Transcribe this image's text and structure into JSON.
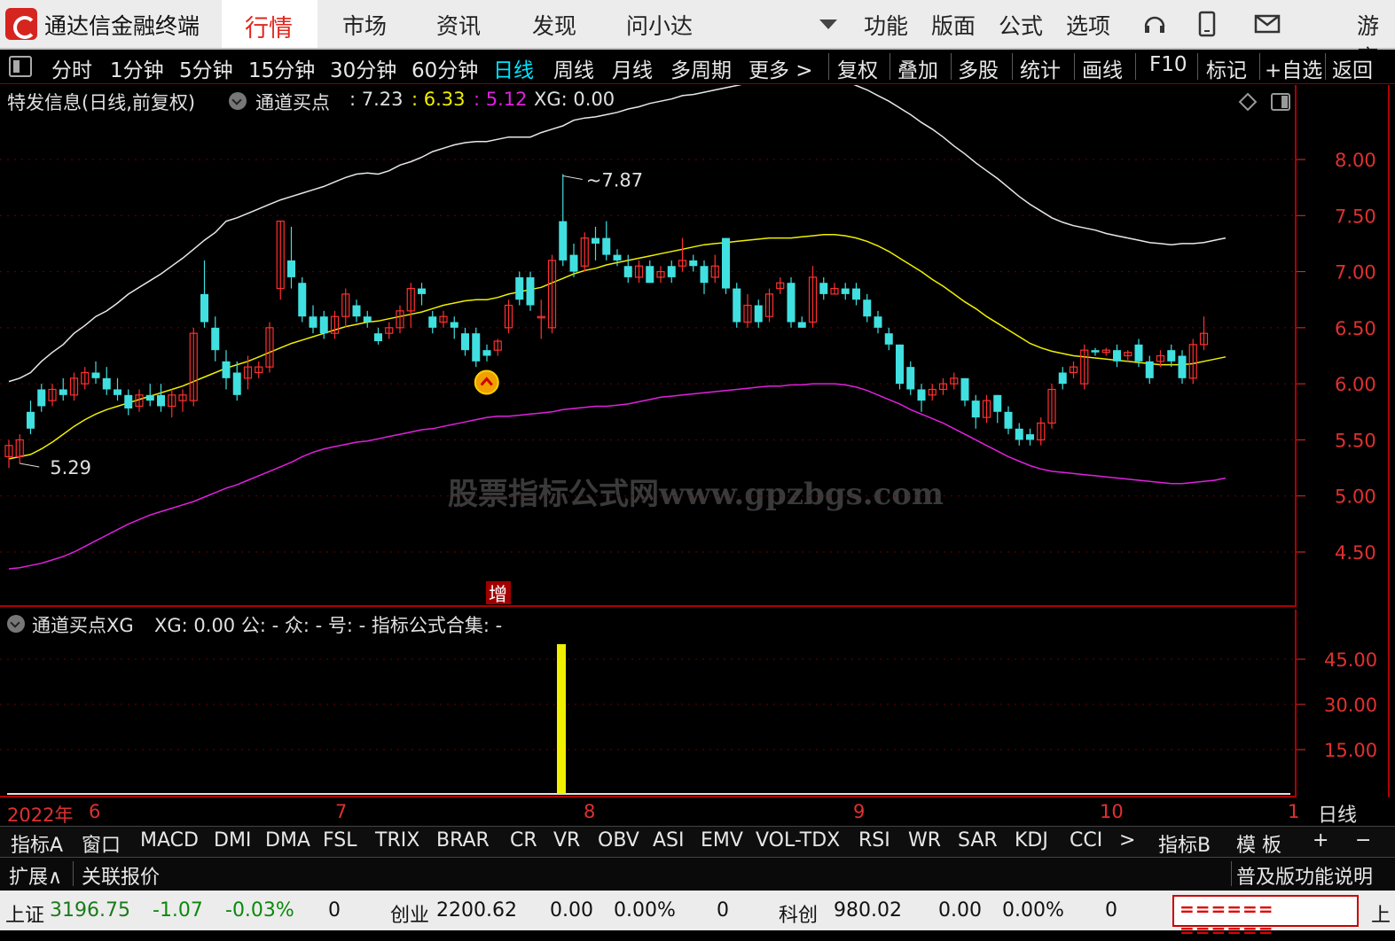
{
  "titlebar": {
    "app_title": "通达信金融终端",
    "menus": [
      "行情",
      "市场",
      "资讯",
      "发现",
      "问小达",
      "功能",
      "版面",
      "公式",
      "选项",
      "游客"
    ],
    "active_menu": "行情"
  },
  "toolbar": {
    "periods": [
      "分时",
      "1分钟",
      "5分钟",
      "15分钟",
      "30分钟",
      "60分钟",
      "日线",
      "周线",
      "月线",
      "多周期",
      "更多 >"
    ],
    "active_period": "日线",
    "actions": [
      "复权",
      "叠加",
      "多股",
      "统计",
      "画线",
      "F10",
      "标记",
      "+自选",
      "返回"
    ]
  },
  "main_chart": {
    "title": "特发信息(日线,前复权)",
    "indicator_name": "通道买点",
    "values": [
      ": 7.23",
      ": 6.33",
      ": 5.12"
    ],
    "xg_label": "XG: 0.00",
    "colors": {
      "upper": "#e8e8e8",
      "mid": "#f0f000",
      "lower": "#e020e0",
      "up_candle": "#ff3030",
      "down_candle": "#40e0e0"
    },
    "high_label": "7.87",
    "low_label": "5.29",
    "y_ticks": [
      "8.00",
      "7.50",
      "7.00",
      "6.50",
      "6.00",
      "5.50",
      "5.00",
      "4.50"
    ],
    "y_tick_values": [
      8.0,
      7.5,
      7.0,
      6.5,
      6.0,
      5.5,
      5.0,
      4.5
    ],
    "badge": "增",
    "watermark": "股票指标公式网www.gpzbgs.com"
  },
  "chart_data": {
    "type": "candlestick",
    "title": "特发信息(日线,前复权)",
    "ylim": [
      4.3,
      8.4
    ],
    "candles": [
      [
        5.35,
        5.45,
        5.25,
        5.5
      ],
      [
        5.35,
        5.5,
        5.29,
        5.55
      ],
      [
        5.75,
        5.6,
        5.55,
        5.85
      ],
      [
        5.95,
        5.8,
        5.75,
        6.0
      ],
      [
        5.85,
        5.95,
        5.8,
        6.0
      ],
      [
        5.95,
        5.9,
        5.85,
        6.05
      ],
      [
        5.9,
        6.05,
        5.85,
        6.1
      ],
      [
        6.0,
        6.1,
        5.95,
        6.15
      ],
      [
        6.1,
        6.05,
        6.0,
        6.2
      ],
      [
        6.05,
        5.95,
        5.9,
        6.15
      ],
      [
        5.95,
        5.9,
        5.85,
        6.05
      ],
      [
        5.9,
        5.78,
        5.72,
        5.95
      ],
      [
        5.8,
        5.9,
        5.75,
        5.95
      ],
      [
        5.9,
        5.85,
        5.8,
        6.0
      ],
      [
        5.9,
        5.8,
        5.75,
        6.0
      ],
      [
        5.8,
        5.9,
        5.7,
        5.95
      ],
      [
        5.85,
        5.9,
        5.75,
        5.95
      ],
      [
        5.85,
        6.45,
        5.8,
        6.5
      ],
      [
        6.8,
        6.55,
        6.5,
        7.1
      ],
      [
        6.5,
        6.3,
        6.2,
        6.6
      ],
      [
        6.2,
        6.05,
        5.95,
        6.3
      ],
      [
        6.1,
        5.9,
        5.85,
        6.2
      ],
      [
        6.05,
        6.15,
        5.95,
        6.25
      ],
      [
        6.1,
        6.15,
        6.05,
        6.2
      ],
      [
        6.15,
        6.5,
        6.1,
        6.55
      ],
      [
        6.85,
        7.45,
        6.75,
        7.45
      ],
      [
        7.1,
        6.95,
        6.85,
        7.4
      ],
      [
        6.9,
        6.6,
        6.55,
        6.95
      ],
      [
        6.6,
        6.5,
        6.45,
        6.7
      ],
      [
        6.6,
        6.45,
        6.4,
        6.65
      ],
      [
        6.45,
        6.6,
        6.4,
        6.65
      ],
      [
        6.6,
        6.8,
        6.5,
        6.85
      ],
      [
        6.7,
        6.6,
        6.55,
        6.75
      ],
      [
        6.6,
        6.55,
        6.5,
        6.65
      ],
      [
        6.45,
        6.38,
        6.35,
        6.5
      ],
      [
        6.45,
        6.5,
        6.4,
        6.55
      ],
      [
        6.5,
        6.65,
        6.45,
        6.7
      ],
      [
        6.65,
        6.85,
        6.5,
        6.9
      ],
      [
        6.85,
        6.8,
        6.7,
        6.9
      ],
      [
        6.6,
        6.5,
        6.45,
        6.65
      ],
      [
        6.55,
        6.6,
        6.5,
        6.65
      ],
      [
        6.55,
        6.5,
        6.4,
        6.6
      ],
      [
        6.45,
        6.3,
        6.25,
        6.5
      ],
      [
        6.45,
        6.2,
        6.15,
        6.5
      ],
      [
        6.3,
        6.25,
        6.2,
        6.35
      ],
      [
        6.3,
        6.38,
        6.25,
        6.4
      ],
      [
        6.5,
        6.7,
        6.45,
        6.75
      ],
      [
        6.95,
        6.75,
        6.7,
        7.0
      ],
      [
        6.95,
        6.7,
        6.65,
        7.0
      ],
      [
        6.6,
        6.6,
        6.4,
        6.75
      ],
      [
        6.5,
        7.1,
        6.45,
        7.15
      ],
      [
        7.45,
        7.1,
        7.05,
        7.87
      ],
      [
        7.15,
        7.0,
        6.95,
        7.25
      ],
      [
        7.05,
        7.3,
        7.0,
        7.35
      ],
      [
        7.3,
        7.25,
        7.1,
        7.4
      ],
      [
        7.3,
        7.15,
        7.1,
        7.45
      ],
      [
        7.15,
        7.1,
        7.05,
        7.2
      ],
      [
        7.05,
        6.95,
        6.9,
        7.15
      ],
      [
        6.95,
        7.05,
        6.9,
        7.1
      ],
      [
        7.05,
        6.9,
        6.9,
        7.1
      ],
      [
        6.95,
        7.0,
        6.9,
        7.05
      ],
      [
        7.05,
        6.95,
        6.9,
        7.1
      ],
      [
        7.05,
        7.1,
        7.0,
        7.3
      ],
      [
        7.1,
        7.05,
        7.0,
        7.15
      ],
      [
        7.05,
        6.9,
        6.8,
        7.1
      ],
      [
        6.95,
        7.05,
        6.9,
        7.15
      ],
      [
        7.3,
        6.85,
        6.8,
        7.3
      ],
      [
        6.85,
        6.55,
        6.5,
        6.9
      ],
      [
        6.55,
        6.7,
        6.5,
        6.8
      ],
      [
        6.7,
        6.55,
        6.5,
        6.75
      ],
      [
        6.6,
        6.8,
        6.55,
        6.85
      ],
      [
        6.85,
        6.9,
        6.8,
        6.95
      ],
      [
        6.9,
        6.55,
        6.5,
        6.95
      ],
      [
        6.55,
        6.5,
        6.5,
        6.6
      ],
      [
        6.55,
        6.95,
        6.5,
        7.05
      ],
      [
        6.9,
        6.8,
        6.75,
        6.95
      ],
      [
        6.8,
        6.85,
        6.8,
        6.9
      ],
      [
        6.85,
        6.8,
        6.75,
        6.9
      ],
      [
        6.85,
        6.75,
        6.7,
        6.9
      ],
      [
        6.75,
        6.6,
        6.55,
        6.8
      ],
      [
        6.6,
        6.5,
        6.45,
        6.65
      ],
      [
        6.45,
        6.35,
        6.3,
        6.5
      ],
      [
        6.35,
        6.0,
        5.95,
        6.35
      ],
      [
        6.15,
        5.95,
        5.9,
        6.2
      ],
      [
        5.95,
        5.85,
        5.75,
        6.0
      ],
      [
        5.9,
        5.95,
        5.85,
        6.0
      ],
      [
        5.95,
        6.0,
        5.9,
        6.05
      ],
      [
        6.0,
        6.05,
        5.95,
        6.1
      ],
      [
        6.05,
        5.85,
        5.8,
        6.05
      ],
      [
        5.85,
        5.7,
        5.6,
        5.9
      ],
      [
        5.7,
        5.85,
        5.65,
        5.9
      ],
      [
        5.9,
        5.75,
        5.65,
        5.9
      ],
      [
        5.75,
        5.6,
        5.55,
        5.8
      ],
      [
        5.6,
        5.5,
        5.45,
        5.65
      ],
      [
        5.55,
        5.5,
        5.45,
        5.6
      ],
      [
        5.5,
        5.65,
        5.45,
        5.7
      ],
      [
        5.65,
        5.95,
        5.6,
        6.0
      ],
      [
        6.1,
        6.0,
        5.95,
        6.15
      ],
      [
        6.1,
        6.15,
        6.05,
        6.2
      ],
      [
        6.0,
        6.3,
        5.95,
        6.35
      ],
      [
        6.3,
        6.28,
        6.25,
        6.32
      ],
      [
        6.28,
        6.3,
        6.25,
        6.32
      ],
      [
        6.3,
        6.2,
        6.15,
        6.35
      ],
      [
        6.25,
        6.28,
        6.2,
        6.3
      ],
      [
        6.35,
        6.2,
        6.15,
        6.4
      ],
      [
        6.2,
        6.05,
        6.0,
        6.25
      ],
      [
        6.2,
        6.25,
        6.15,
        6.3
      ],
      [
        6.3,
        6.2,
        6.15,
        6.35
      ],
      [
        6.25,
        6.05,
        6.0,
        6.3
      ],
      [
        6.05,
        6.35,
        6.0,
        6.4
      ],
      [
        6.35,
        6.45,
        6.3,
        6.6
      ]
    ],
    "upper_band": [
      6.02,
      6.05,
      6.1,
      6.2,
      6.28,
      6.35,
      6.45,
      6.52,
      6.6,
      6.65,
      6.72,
      6.8,
      6.86,
      6.92,
      6.98,
      7.05,
      7.12,
      7.2,
      7.28,
      7.35,
      7.45,
      7.48,
      7.52,
      7.56,
      7.6,
      7.64,
      7.67,
      7.7,
      7.73,
      7.76,
      7.8,
      7.84,
      7.87,
      7.88,
      7.87,
      7.9,
      7.95,
      7.98,
      8.02,
      8.07,
      8.1,
      8.13,
      8.15,
      8.16,
      8.16,
      8.18,
      8.2,
      8.2,
      8.2,
      8.24,
      8.27,
      8.3,
      8.35,
      8.37,
      8.38,
      8.4,
      8.42,
      8.45,
      8.47,
      8.5,
      8.52,
      8.54,
      8.57,
      8.58,
      8.6,
      8.62,
      8.64,
      8.66,
      8.68,
      8.69,
      8.7,
      8.72,
      8.73,
      8.73,
      8.74,
      8.73,
      8.72,
      8.7,
      8.66,
      8.62,
      8.57,
      8.52,
      8.46,
      8.4,
      8.33,
      8.27,
      8.2,
      8.12,
      8.05,
      7.97,
      7.9,
      7.83,
      7.75,
      7.67,
      7.6,
      7.54,
      7.48,
      7.44,
      7.41,
      7.39,
      7.37,
      7.34,
      7.32,
      7.3,
      7.28,
      7.26,
      7.25,
      7.24,
      7.25,
      7.25,
      7.26,
      7.28,
      7.3
    ],
    "mid_band": [
      5.33,
      5.35,
      5.37,
      5.42,
      5.48,
      5.55,
      5.62,
      5.68,
      5.73,
      5.77,
      5.8,
      5.83,
      5.86,
      5.89,
      5.92,
      5.95,
      5.98,
      6.02,
      6.06,
      6.1,
      6.14,
      6.17,
      6.2,
      6.24,
      6.28,
      6.32,
      6.36,
      6.39,
      6.42,
      6.45,
      6.48,
      6.51,
      6.53,
      6.55,
      6.56,
      6.58,
      6.6,
      6.62,
      6.64,
      6.67,
      6.7,
      6.72,
      6.74,
      6.75,
      6.75,
      6.77,
      6.8,
      6.82,
      6.84,
      6.86,
      6.9,
      6.94,
      6.98,
      7.01,
      7.03,
      7.06,
      7.08,
      7.1,
      7.12,
      7.14,
      7.16,
      7.18,
      7.2,
      7.22,
      7.24,
      7.25,
      7.26,
      7.27,
      7.28,
      7.29,
      7.3,
      7.3,
      7.3,
      7.31,
      7.32,
      7.33,
      7.33,
      7.32,
      7.3,
      7.27,
      7.23,
      7.18,
      7.12,
      7.06,
      7.0,
      6.93,
      6.87,
      6.8,
      6.73,
      6.67,
      6.6,
      6.54,
      6.48,
      6.42,
      6.36,
      6.32,
      6.29,
      6.27,
      6.25,
      6.24,
      6.23,
      6.22,
      6.21,
      6.2,
      6.19,
      6.18,
      6.17,
      6.17,
      6.17,
      6.18,
      6.2,
      6.22,
      6.24
    ],
    "lower_band": [
      4.35,
      4.36,
      4.38,
      4.4,
      4.43,
      4.46,
      4.5,
      4.55,
      4.6,
      4.65,
      4.7,
      4.75,
      4.79,
      4.83,
      4.86,
      4.89,
      4.92,
      4.95,
      4.99,
      5.03,
      5.07,
      5.1,
      5.14,
      5.18,
      5.22,
      5.26,
      5.3,
      5.35,
      5.39,
      5.42,
      5.44,
      5.46,
      5.48,
      5.49,
      5.51,
      5.53,
      5.55,
      5.57,
      5.59,
      5.6,
      5.62,
      5.64,
      5.66,
      5.68,
      5.7,
      5.71,
      5.71,
      5.72,
      5.73,
      5.74,
      5.75,
      5.77,
      5.78,
      5.79,
      5.8,
      5.8,
      5.81,
      5.82,
      5.84,
      5.86,
      5.88,
      5.89,
      5.9,
      5.91,
      5.92,
      5.93,
      5.94,
      5.95,
      5.96,
      5.97,
      5.98,
      5.98,
      5.99,
      5.99,
      6.0,
      6.0,
      6.0,
      5.99,
      5.97,
      5.94,
      5.9,
      5.86,
      5.82,
      5.77,
      5.73,
      5.69,
      5.65,
      5.6,
      5.55,
      5.5,
      5.45,
      5.4,
      5.35,
      5.31,
      5.27,
      5.24,
      5.22,
      5.21,
      5.2,
      5.19,
      5.18,
      5.17,
      5.16,
      5.15,
      5.14,
      5.13,
      5.12,
      5.11,
      5.11,
      5.12,
      5.13,
      5.14,
      5.16
    ],
    "buy_signal_index": 43,
    "sub_indicator": {
      "type": "bar",
      "index": 43,
      "value": 50,
      "ylim": [
        0,
        55
      ]
    }
  },
  "sub_chart": {
    "title": "通道买点XG",
    "text": "XG: 0.00  公: -  众: -  号: -  指标公式合集: -",
    "y_ticks": [
      "45.00",
      "30.00",
      "15.00"
    ],
    "y_tick_values": [
      45,
      30,
      15
    ]
  },
  "date_axis": [
    "2022年",
    "6",
    "7",
    "8",
    "9",
    "10",
    "1"
  ],
  "date_axis_right": "日线",
  "indicator_tabs": [
    "指标A",
    "窗口",
    "MACD",
    "DMI",
    "DMA",
    "FSL",
    "TRIX",
    "BRAR",
    "CR",
    "VR",
    "OBV",
    "ASI",
    "EMV",
    "VOL-TDX",
    "RSI",
    "WR",
    "SAR",
    "KDJ",
    "CCI",
    ">",
    "指标B",
    "模 板",
    "+",
    "−"
  ],
  "expand_bar": {
    "expand": "扩展∧",
    "related": "关联报价",
    "help": "普及版功能说明"
  },
  "status": {
    "sh": {
      "name": "上证",
      "value": "3196.75",
      "chg": "-1.07",
      "pct": "-0.03%",
      "vol": "0"
    },
    "cy": {
      "name": "创业",
      "value": "2200.62",
      "chg": "0.00",
      "pct": "0.00%",
      "vol": "0"
    },
    "kc": {
      "name": "科创",
      "value": "980.02",
      "chg": "0.00",
      "pct": "0.00%",
      "vol": "0"
    },
    "dashes": "====== ======",
    "tail": "上"
  }
}
